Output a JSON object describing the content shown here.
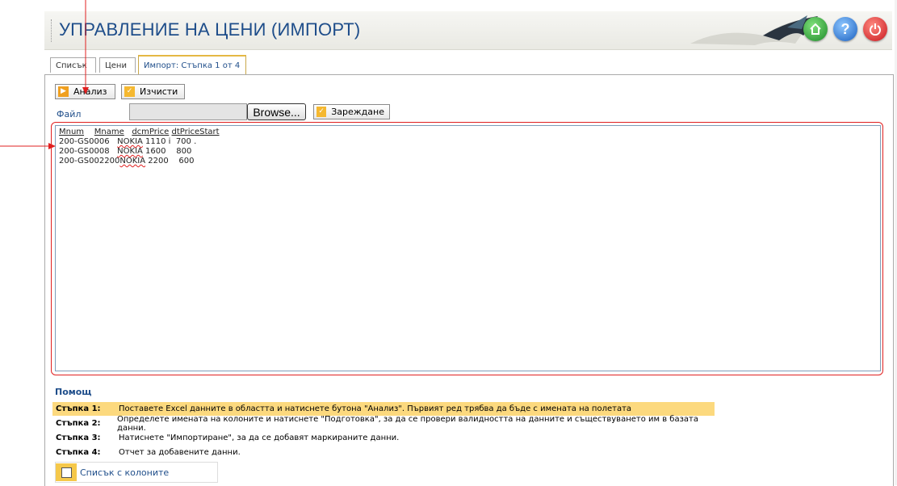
{
  "header": {
    "title": "УПРАВЛЕНИЕ НА ЦЕНИ (ИМПОРТ)",
    "buttons": [
      "home-icon",
      "help-icon",
      "power-icon"
    ]
  },
  "tabs": [
    {
      "label": "Списък"
    },
    {
      "label": "Цени"
    },
    {
      "label": "Импорт: Стъпка 1 от 4",
      "active": true
    }
  ],
  "toolbar": {
    "analyze_label": "Анализ",
    "clear_label": "Изчисти"
  },
  "file": {
    "label": "Файл",
    "browse_label": "Browse...",
    "upload_label": "Зареждане"
  },
  "data_area": {
    "header": [
      "Mnum",
      "Mname",
      "dcmPrice",
      "dtPriceStart"
    ],
    "rows": [
      [
        "200-GS0006",
        "NOKIA",
        "1110 i",
        "700 ."
      ],
      [
        "200-GS0008",
        "NOKIA",
        "1600",
        "800"
      ],
      [
        "200-GS002200",
        "NOKIA",
        "2200",
        "600"
      ]
    ]
  },
  "help": {
    "title": "Помощ",
    "steps": [
      {
        "label": "Стъпка 1:",
        "text": "Поставете Excel данните в областта и натиснете бутона \"Анализ\". Първият ред трябва да бъде с имената на полетата",
        "highlight": true
      },
      {
        "label": "Стъпка 2:",
        "text": "Определете имената на колоните и натиснете \"Подготовка\", за да се провери валидността на данните и съществуването им в базата данни."
      },
      {
        "label": "Стъпка 3:",
        "text": "Натиснете \"Импортиране\", за да се добавят маркираните данни."
      },
      {
        "label": "Стъпка 4:",
        "text": "Отчет за добавените данни."
      }
    ]
  },
  "columns_checkbox": {
    "label": "Списък с колоните"
  },
  "colors": {
    "accent": "#1e4d8a",
    "highlight": "#fcd97e",
    "annotation": "#e02020"
  }
}
